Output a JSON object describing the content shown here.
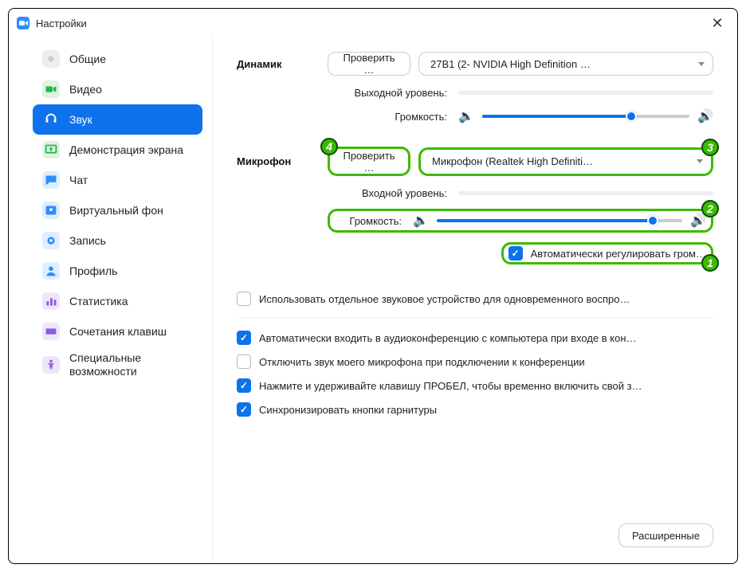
{
  "window": {
    "title": "Настройки"
  },
  "sidebar": {
    "items": [
      {
        "label": "Общие",
        "icon": "gear"
      },
      {
        "label": "Видео",
        "icon": "camera"
      },
      {
        "label": "Звук",
        "icon": "headphones",
        "active": true
      },
      {
        "label": "Демонстрация экрана",
        "icon": "screen"
      },
      {
        "label": "Чат",
        "icon": "chat"
      },
      {
        "label": "Виртуальный фон",
        "icon": "vbg"
      },
      {
        "label": "Запись",
        "icon": "record"
      },
      {
        "label": "Профиль",
        "icon": "profile"
      },
      {
        "label": "Статистика",
        "icon": "stats"
      },
      {
        "label": "Сочетания клавиш",
        "icon": "keyboard"
      },
      {
        "label": "Специальные возможности",
        "icon": "acc"
      }
    ]
  },
  "speaker": {
    "section_label": "Динамик",
    "test_button": "Проверить …",
    "device": "27B1 (2- NVIDIA High Definition …",
    "output_level_label": "Выходной уровень:",
    "volume_label": "Громкость:",
    "volume_percent": 72
  },
  "mic": {
    "section_label": "Микрофон",
    "test_button": "Проверить …",
    "device": "Микрофон (Realtek High Definiti…",
    "input_level_label": "Входной уровень:",
    "volume_label": "Громкость:",
    "volume_percent": 88,
    "auto_adjust_label": "Автоматически регулировать гром…"
  },
  "options": {
    "separate_device": {
      "label": "Использовать отдельное звуковое устройство для одновременного воспро…",
      "checked": false
    },
    "auto_join": {
      "label": "Автоматически входить в аудиоконференцию с компьютера при входе в кон…",
      "checked": true
    },
    "mute_mic": {
      "label": "Отключить звук моего микрофона при подключении к конференции",
      "checked": false
    },
    "push_space": {
      "label": "Нажмите и удерживайте клавишу ПРОБЕЛ, чтобы временно включить свой з…",
      "checked": true
    },
    "sync_headset": {
      "label": "Синхронизировать кнопки гарнитуры",
      "checked": true
    }
  },
  "footer": {
    "advanced_button": "Расширенные"
  },
  "annotations": {
    "n1": "1",
    "n2": "2",
    "n3": "3",
    "n4": "4"
  },
  "colors": {
    "accent": "#0E72ED",
    "highlight": "#3bba00"
  }
}
